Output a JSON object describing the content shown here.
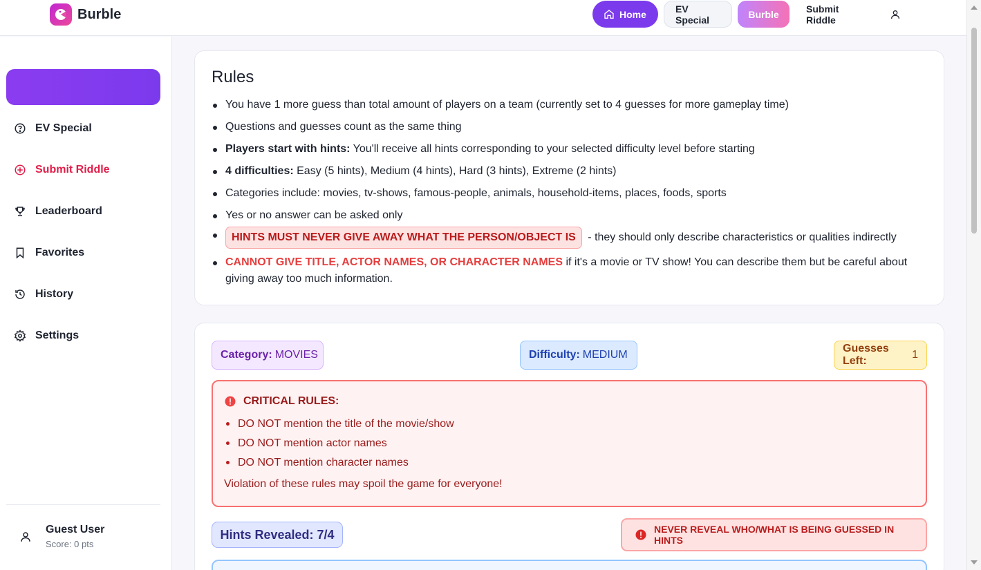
{
  "app": {
    "name": "Burble"
  },
  "nav": {
    "home": "Home",
    "ev_special": "EV Special",
    "burble": "Burble",
    "submit_riddle": "Submit Riddle"
  },
  "sidebar": {
    "items": [
      {
        "label": "EV Special",
        "icon": "question-circle-icon"
      },
      {
        "label": "Submit Riddle",
        "icon": "plus-circle-icon",
        "active": true
      },
      {
        "label": "Leaderboard",
        "icon": "trophy-icon"
      },
      {
        "label": "Favorites",
        "icon": "bookmark-icon"
      },
      {
        "label": "History",
        "icon": "history-icon"
      },
      {
        "label": "Settings",
        "icon": "gear-icon"
      }
    ],
    "user": {
      "name": "Guest User",
      "score": "Score: 0 pts"
    }
  },
  "rules": {
    "title": "Rules",
    "items": {
      "r1": "You have 1 more guess than total amount of players on a team (currently set to 4 guesses for more gameplay time)",
      "r2": "Questions and guesses count as the same thing",
      "r3_bold": "Players start with hints:",
      "r3_rest": " You'll receive all hints corresponding to your selected difficulty level before starting",
      "r4_bold": "4 difficulties:",
      "r4_rest": " Easy (5 hints), Medium (4 hints), Hard (3 hints), Extreme (2 hints)",
      "r5": "Categories include: movies, tv-shows, famous-people, animals, household-items, places, foods, sports",
      "r6": "Yes or no answer can be asked only",
      "r7_box": "HINTS MUST NEVER GIVE AWAY WHAT THE PERSON/OBJECT IS",
      "r7_rest": " - they should only describe characteristics or qualities indirectly",
      "r8_red": "CANNOT GIVE TITLE, ACTOR NAMES, OR CHARACTER NAMES",
      "r8_rest": " if it's a movie or TV show! You can describe them but be careful about giving away too much information."
    }
  },
  "game": {
    "category_label": "Category:",
    "category_value": "MOVIES",
    "difficulty_label": "Difficulty:",
    "difficulty_value": "MEDIUM",
    "guesses_label": "Guesses Left:",
    "guesses_value": "1",
    "critical": {
      "title": "CRITICAL RULES:",
      "items": [
        "DO NOT mention the title of the movie/show",
        "DO NOT mention actor names",
        "DO NOT mention character names"
      ],
      "footer": "Violation of these rules may spoil the game for everyone!"
    },
    "hints_revealed": "Hints Revealed: 7/4",
    "never_reveal": "NEVER REVEAL WHO/WHAT IS BEING GUESSED IN HINTS"
  },
  "colors": {
    "accent": "#7c3aed",
    "danger": "#e53e3e",
    "brand_gradient_start": "#c026d3",
    "brand_gradient_end": "#ec4899"
  }
}
